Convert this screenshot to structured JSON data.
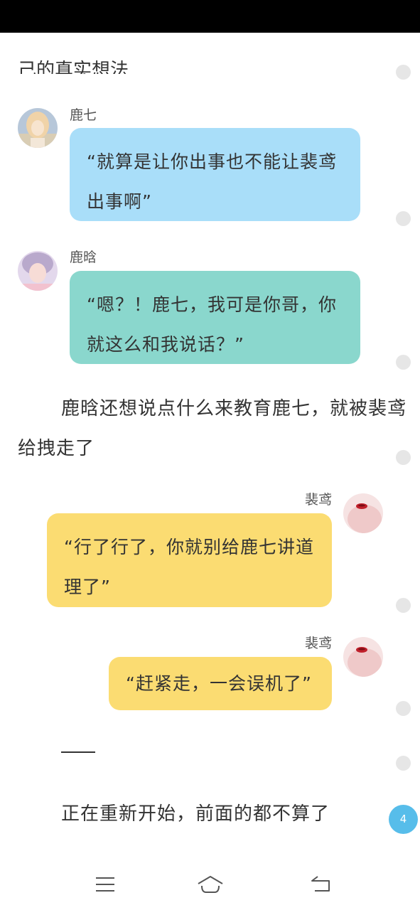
{
  "top_clipped_text": "己的真实想法",
  "messages": [
    {
      "sender": "鹿七",
      "lines": [
        "“就算是让你出事也不能让裴鸢",
        "出事啊”"
      ]
    },
    {
      "sender": "鹿晗",
      "lines": [
        "“嗯？！鹿七，我可是你哥，你",
        "就这么和我说话？”"
      ]
    },
    {
      "sender": "裴鸢",
      "lines": [
        "“行了行了，你就别给鹿七讲道",
        "理了”"
      ]
    },
    {
      "sender": "裴鸢",
      "lines": [
        "“赶紧走，一会误机了”"
      ]
    }
  ],
  "narration": {
    "line1": "鹿晗还想说点什么来教育鹿七，就被裴鸢",
    "line2": "给拽走了"
  },
  "restart_text": "正在重新开始，前面的都不算了",
  "page_badge": "4",
  "colors": {
    "blue_bubble": "#a9def9",
    "teal_bubble": "#8ad7cd",
    "yellow_bubble": "#fbdc72",
    "badge": "#57bdea"
  },
  "nav": {
    "icons": [
      "menu-icon",
      "home-icon",
      "back-icon"
    ]
  }
}
